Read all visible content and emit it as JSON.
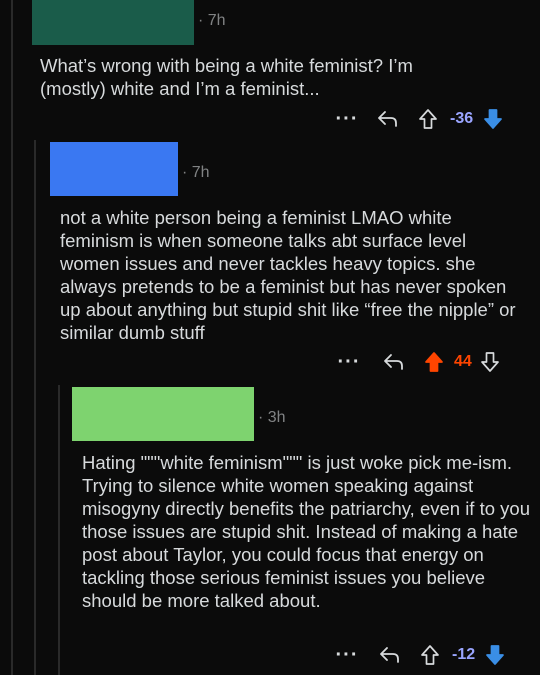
{
  "colors": {
    "background": "#0b0b0b",
    "text": "#d7dadc",
    "muted": "#818384",
    "upvote_active": "#ff4500",
    "downvote_active": "#3a8ee6",
    "score_downvoted": "#9aa5ff",
    "score_upvoted": "#ff4500"
  },
  "comments": [
    {
      "username_redacted_color": "#1a5c4a",
      "timestamp": "· 7h",
      "body": "What’s wrong with being a white feminist? I’m (mostly) white and I’m a feminist...",
      "more_label": "···",
      "score": "-36",
      "vote_state": "downvoted"
    },
    {
      "username_redacted_color": "#3a78f2",
      "timestamp": "· 7h",
      "body": "not a white person being a feminist LMAO white feminism is when someone talks abt surface level women issues and never tackles heavy topics. she always pretends to be a feminist but has never spoken up about anything but stupid shit like “free the nipple” or similar dumb stuff",
      "more_label": "···",
      "score": "44",
      "vote_state": "upvoted"
    },
    {
      "username_redacted_color": "#7ed36f",
      "timestamp": "· 3h",
      "body": "Hating \"\"\"white feminism\"\"\" is just woke pick me-ism. Trying to silence white women speaking against misogyny directly benefits the patriarchy, even if to you those issues are stupid shit. Instead of making a hate post about Taylor, you could focus that energy on tackling those serious feminist issues you believe should be more talked about.",
      "more_label": "···",
      "score": "-12",
      "vote_state": "downvoted"
    }
  ]
}
